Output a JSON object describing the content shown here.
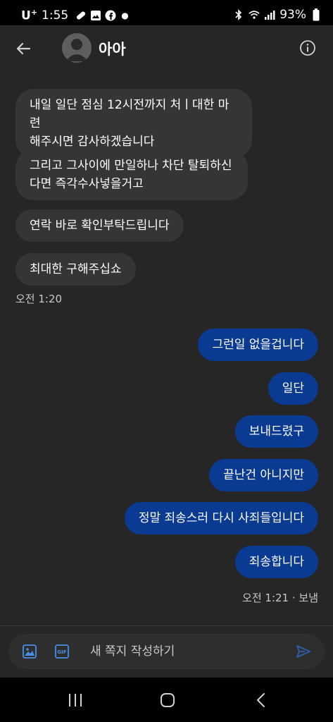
{
  "status_bar": {
    "carrier": "U",
    "carrier_sup": "+",
    "time": "1:55",
    "battery": "93%"
  },
  "header": {
    "title": "아아"
  },
  "messages": [
    {
      "dir": "in",
      "text": "내일 일단 점심 12시전까지 처ㅣ대한 마련\n해주시면 감사하겠습니다"
    },
    {
      "dir": "in",
      "text": "그리고 그사이에 만일하나 차단 탈퇴하신\n다면 즉각수사넣을거고"
    },
    {
      "dir": "in",
      "text": "연락 바로 확인부탁드립니다"
    },
    {
      "dir": "in",
      "text": "최대한 구해주십쇼"
    },
    {
      "dir": "out",
      "text": "그런일 없을겁니다"
    },
    {
      "dir": "out",
      "text": "일단"
    },
    {
      "dir": "out",
      "text": "보내드렸구"
    },
    {
      "dir": "out",
      "text": "끝난건 아니지만"
    },
    {
      "dir": "out",
      "text": "정말 죄송스러 다시 사죄들입니다"
    },
    {
      "dir": "out",
      "text": "죄송합니다"
    }
  ],
  "timestamps": {
    "incoming": "오전 1:20",
    "outgoing": "오전 1:21 · 보냄"
  },
  "composer": {
    "placeholder": "새 쪽지 작성하기"
  },
  "colors": {
    "background": "#262626",
    "incoming_bubble": "#353535",
    "outgoing_bubble": "#0a3a91",
    "accent": "#4a8fe8"
  },
  "icons": {
    "back": "arrow-left-icon",
    "info": "info-icon",
    "image": "image-icon",
    "gif": "gif-icon",
    "send": "send-icon"
  }
}
